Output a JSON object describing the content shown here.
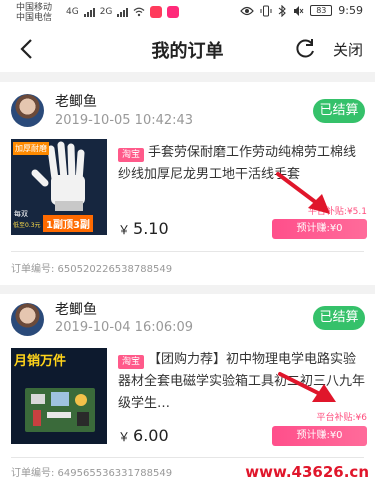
{
  "status_bar": {
    "carrier_1": "中国移动",
    "carrier_2": "中国电信",
    "net_1": "4G",
    "net_2": "2G",
    "battery": "83",
    "time": "9:59"
  },
  "header": {
    "title": "我的订单",
    "close_label": "关闭"
  },
  "orders": [
    {
      "user_name": "老鲫鱼",
      "date": "2019-10-05 10:42:43",
      "status": "已结算",
      "platform_tag": "淘宝",
      "product_title": "手套劳保耐磨工作劳动纯棉劳工棉线纱线加厚尼龙男工地干活线手套",
      "thumb_text_1": "加厚耐磨",
      "thumb_text_2": "1副顶3副",
      "thumb_text_3": "每双",
      "thumb_text_4": "低至0.3元",
      "subsidy": "平台补贴:¥5.1",
      "currency": "￥",
      "price": "5.10",
      "estimated_earn": "预计赚:¥0",
      "order_no": "订单编号: 650520226538788549"
    },
    {
      "user_name": "老鲫鱼",
      "date": "2019-10-04 16:06:09",
      "status": "已结算",
      "platform_tag": "淘宝",
      "product_title": "【团购力荐】初中物理电学电路实验器材全套电磁学实验箱工具初二初三八九年级学生…",
      "thumb_text_1": "月销万件",
      "subsidy": "平台补贴:¥6",
      "currency": "￥",
      "price": "6.00",
      "estimated_earn": "预计赚:¥0",
      "order_no": "订单编号: 649565536331788549"
    }
  ],
  "watermark": "www.43626.cn",
  "colors": {
    "settled_green": "#35c16a",
    "brand_pink": "#ff4f8b",
    "annotation_red": "#e0162b"
  }
}
